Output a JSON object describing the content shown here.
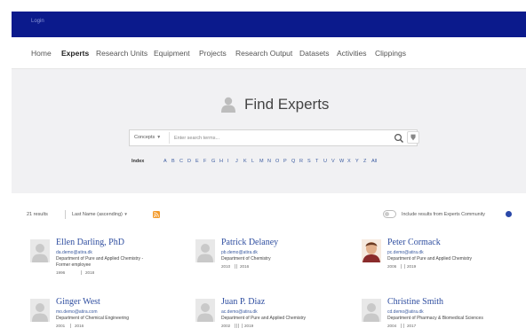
{
  "topbar": {
    "login": "Login"
  },
  "nav": {
    "items": [
      "Home",
      "Experts",
      "Research Units",
      "Equipment",
      "Projects",
      "Research Output",
      "Datasets",
      "Activities",
      "Clippings"
    ],
    "active": "Experts"
  },
  "hero": {
    "title": "Find Experts",
    "search": {
      "concepts_label": "Concepts",
      "placeholder": "Enter search terms..."
    },
    "index_label": "Index",
    "letters": [
      "A",
      "B",
      "C",
      "D",
      "E",
      "F",
      "G",
      "H",
      "I",
      "J",
      "K",
      "L",
      "M",
      "N",
      "O",
      "P",
      "Q",
      "R",
      "S",
      "T",
      "U",
      "V",
      "W",
      "X",
      "Y",
      "Z",
      "All"
    ]
  },
  "results": {
    "count": "21 results",
    "sort": "Last Name (ascending)",
    "community_label": "Include results from Experts Community"
  },
  "experts": [
    {
      "name": "Ellen Darling, PhD",
      "email": "da.demo@atira.dk",
      "dept": "Department of Pure and Applied Chemistry -",
      "note": "Former employee",
      "years_start": "1996",
      "years_end": "2018",
      "photo": false
    },
    {
      "name": "Patrick Delaney",
      "email": "pb.demo@atira.dk",
      "dept": "Department of Chemistry",
      "note": "",
      "years_start": "2010",
      "years_end": "2016",
      "photo": false
    },
    {
      "name": "Peter Cormack",
      "email": "pc.demo@atira.dk",
      "dept": "Department of Pure and Applied Chemistry",
      "note": "",
      "years_start": "2006",
      "years_end": "2019",
      "photo": true
    },
    {
      "name": "Ginger West",
      "email": "mo.demo@atira.com",
      "dept": "Department of Chemical Engineering",
      "note": "",
      "years_start": "2001",
      "years_end": "2016",
      "photo": false
    },
    {
      "name": "Juan P. Diaz",
      "email": "ac.demo@atira.dk",
      "dept": "Department of Pure and Applied Chemistry",
      "note": "",
      "years_start": "2002",
      "years_end": "2019",
      "photo": false
    },
    {
      "name": "Christine Smith",
      "email": "cd.demo@atira.dk",
      "dept": "Department of Pharmacy & Biomedical Sciences",
      "note": "",
      "years_start": "2004",
      "years_end": "2017",
      "photo": false
    }
  ],
  "colors": {
    "topbar": "#0b1a8c",
    "link": "#2f4ea0",
    "hero_bg": "#f1f1f3",
    "info_dot": "#2a48a8"
  },
  "icons": {
    "person": "person-icon",
    "search": "search-icon",
    "filter": "filter-icon",
    "rss": "rss-icon"
  }
}
